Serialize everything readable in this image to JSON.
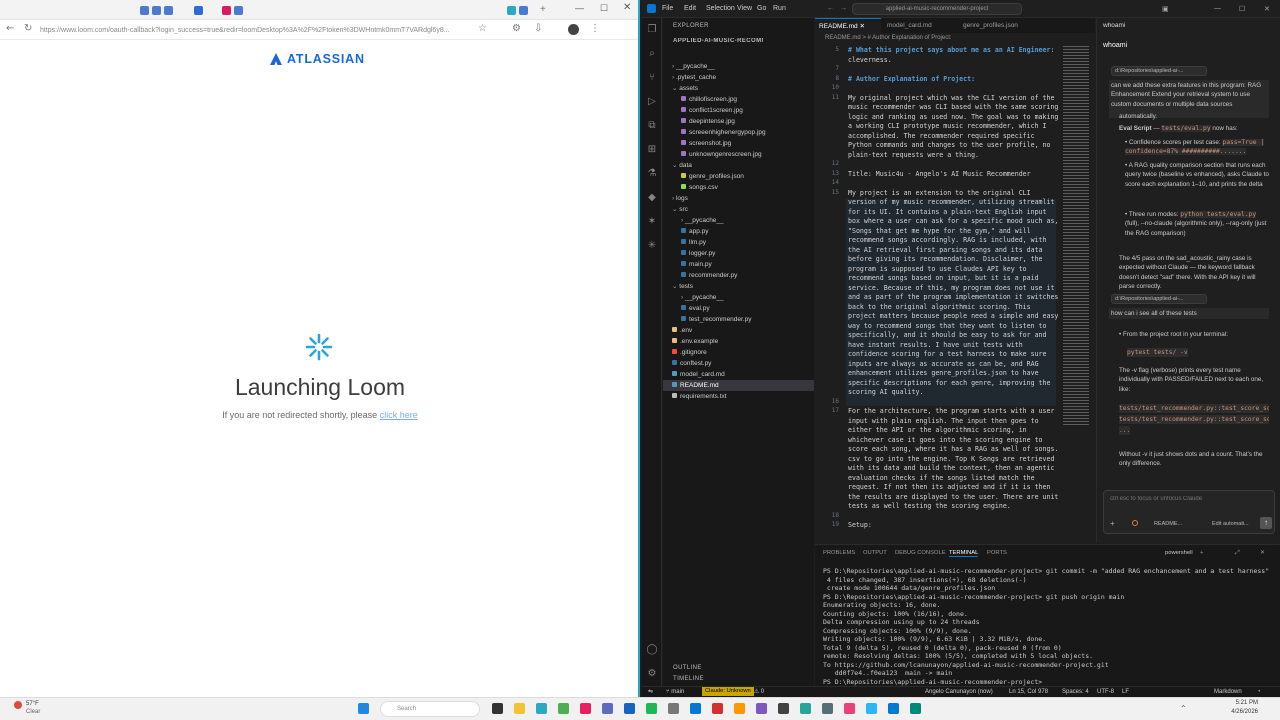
{
  "browser": {
    "url": "https://www.loom.com/oauth-callback?login_success=true&redir=loomDesktop%3A%2F%2Ftoken%3DWHntmk0mmT7VARdgl6y8...",
    "brand": "ATLASSIAN",
    "title": "Launching Loom",
    "subtitle_prefix": "If you are not redirected shortly, please",
    "subtitle_link": "click here",
    "accent": "#1868db"
  },
  "vscode": {
    "menu": [
      "File",
      "Edit",
      "Selection",
      "View",
      "Go",
      "Run"
    ],
    "command_center": "applied-ai-music-recommender-project",
    "explorer": {
      "header": "EXPLORER",
      "project": "APPLIED-AI-MUSIC-RECOMME...",
      "items": [
        {
          "label": "__pycache__",
          "indent": 1,
          "kind": "folder",
          "color": "#bbbbbb"
        },
        {
          "label": ".pytest_cache",
          "indent": 1,
          "kind": "folder",
          "color": "#bbbbbb"
        },
        {
          "label": "assets",
          "indent": 1,
          "kind": "folder-open",
          "color": "#bbbbbb"
        },
        {
          "label": "chillofiscreen.jpg",
          "indent": 2,
          "kind": "file",
          "color": "#a074c4"
        },
        {
          "label": "conflict1screen.jpg",
          "indent": 2,
          "kind": "file",
          "color": "#a074c4"
        },
        {
          "label": "deepintense.jpg",
          "indent": 2,
          "kind": "file",
          "color": "#a074c4"
        },
        {
          "label": "screeenhighenergypop.jpg",
          "indent": 2,
          "kind": "file",
          "color": "#a074c4"
        },
        {
          "label": "screenshot.jpg",
          "indent": 2,
          "kind": "file",
          "color": "#a074c4"
        },
        {
          "label": "unknowngenrescreen.jpg",
          "indent": 2,
          "kind": "file",
          "color": "#a074c4"
        },
        {
          "label": "data",
          "indent": 1,
          "kind": "folder-open",
          "color": "#bbbbbb"
        },
        {
          "label": "genre_profiles.json",
          "indent": 2,
          "kind": "file",
          "color": "#cbcb41"
        },
        {
          "label": "songs.csv",
          "indent": 2,
          "kind": "file",
          "color": "#89e051"
        },
        {
          "label": "logs",
          "indent": 1,
          "kind": "folder",
          "color": "#bbbbbb"
        },
        {
          "label": "src",
          "indent": 1,
          "kind": "folder-open",
          "color": "#bbbbbb"
        },
        {
          "label": "__pycache__",
          "indent": 2,
          "kind": "folder",
          "color": "#bbbbbb"
        },
        {
          "label": "app.py",
          "indent": 2,
          "kind": "file",
          "color": "#3572a5"
        },
        {
          "label": "llm.py",
          "indent": 2,
          "kind": "file",
          "color": "#3572a5"
        },
        {
          "label": "logger.py",
          "indent": 2,
          "kind": "file",
          "color": "#3572a5"
        },
        {
          "label": "main.py",
          "indent": 2,
          "kind": "file",
          "color": "#3572a5"
        },
        {
          "label": "recommender.py",
          "indent": 2,
          "kind": "file",
          "color": "#3572a5"
        },
        {
          "label": "tests",
          "indent": 1,
          "kind": "folder-open",
          "color": "#bbbbbb"
        },
        {
          "label": "__pycache__",
          "indent": 2,
          "kind": "folder",
          "color": "#bbbbbb"
        },
        {
          "label": "eval.py",
          "indent": 2,
          "kind": "file",
          "color": "#3572a5"
        },
        {
          "label": "test_recommender.py",
          "indent": 2,
          "kind": "file",
          "color": "#3572a5"
        },
        {
          "label": ".env",
          "indent": 1,
          "kind": "file",
          "color": "#e5c07b"
        },
        {
          "label": ".env.example",
          "indent": 1,
          "kind": "file",
          "color": "#e5c07b"
        },
        {
          "label": ".gitignore",
          "indent": 1,
          "kind": "file",
          "color": "#f14e32"
        },
        {
          "label": "conftest.py",
          "indent": 1,
          "kind": "file",
          "color": "#3572a5"
        },
        {
          "label": "model_card.md",
          "indent": 1,
          "kind": "file",
          "color": "#519aba"
        },
        {
          "label": "README.md",
          "indent": 1,
          "kind": "file",
          "color": "#519aba",
          "selected": true
        },
        {
          "label": "requirements.txt",
          "indent": 1,
          "kind": "file",
          "color": "#bbbbbb"
        }
      ],
      "outline": "OUTLINE",
      "timeline": "TIMELINE"
    },
    "editor_tabs": [
      "README.md",
      "model_card.md",
      "genre_profiles.json"
    ],
    "chat_tab": "whoami",
    "breadcrumb": "README.md > # Author Explanation of Project:",
    "code_lines": [
      {
        "n": "5",
        "t": "# What this project says about me as an AI Engineer:",
        "h": true
      },
      {
        "n": "",
        "t": "cleverness."
      },
      {
        "n": "7",
        "t": ""
      },
      {
        "n": "8",
        "t": "# Author Explanation of Project:",
        "h": true
      },
      {
        "n": "10",
        "t": ""
      },
      {
        "n": "11",
        "t": "My original project which was the CLI version of the"
      },
      {
        "n": "",
        "t": "music recommender was CLI based with the same scoring"
      },
      {
        "n": "",
        "t": "logic and ranking as used now. The goal was to making"
      },
      {
        "n": "",
        "t": "a working CLI prototype music recommender, which I"
      },
      {
        "n": "",
        "t": "accomplished. The recommender required specific"
      },
      {
        "n": "",
        "t": "Python commands and changes to the user profile, no"
      },
      {
        "n": "",
        "t": "plain-text requests were a thing."
      },
      {
        "n": "12",
        "t": ""
      },
      {
        "n": "13",
        "t": "Title: Music4u - Angelo's AI Music Recommender"
      },
      {
        "n": "14",
        "t": ""
      },
      {
        "n": "15",
        "t": "My project is an extension to the original CLI"
      },
      {
        "n": "",
        "t": "version of my music recommender, utilizing streamlit"
      },
      {
        "n": "",
        "t": "for its UI. It contains a plain-text English input"
      },
      {
        "n": "",
        "t": "box where a user can ask for a specific mood such as,"
      },
      {
        "n": "",
        "t": "\"Songs that get me hype for the gym,\" and will"
      },
      {
        "n": "",
        "t": "recommend songs accordingly. RAG is included, with"
      },
      {
        "n": "",
        "t": "the AI retrieval first parsing songs and its data"
      },
      {
        "n": "",
        "t": "before giving its recommendation. Disclaimer, the"
      },
      {
        "n": "",
        "t": "program is supposed to use Claudes API key to"
      },
      {
        "n": "",
        "t": "recommend songs based on input, but it is a paid"
      },
      {
        "n": "",
        "t": "service. Because of this, my program does not use it"
      },
      {
        "n": "",
        "t": "and as part of the program implementation it switches"
      },
      {
        "n": "",
        "t": "back to the original algorithmic scoring. This"
      },
      {
        "n": "",
        "t": "project matters because people need a simple and easy"
      },
      {
        "n": "",
        "t": "way to recommend songs that they want to listen to"
      },
      {
        "n": "",
        "t": "specifically, and it should be easy to ask for and"
      },
      {
        "n": "",
        "t": "have instant results. I have unit tests with"
      },
      {
        "n": "",
        "t": "confidence scoring for a test harness to make sure"
      },
      {
        "n": "",
        "t": "inputs are always as accurate as can be, and RAG"
      },
      {
        "n": "",
        "t": "enhancement utilizes genre_profiles.json to have"
      },
      {
        "n": "",
        "t": "specific descriptions for each genre, improving the"
      },
      {
        "n": "",
        "t": "scoring AI quality."
      },
      {
        "n": "16",
        "t": ""
      },
      {
        "n": "17",
        "t": "For the architecture, the program starts with a user"
      },
      {
        "n": "",
        "t": "input with plain english. The input then goes to"
      },
      {
        "n": "",
        "t": "either the API or the algorithmic scoring, in"
      },
      {
        "n": "",
        "t": "whichever case it goes into the scoring engine to"
      },
      {
        "n": "",
        "t": "score each song, where it has a RAG as well of songs."
      },
      {
        "n": "",
        "t": "csv to go into the engine. Top K Songs are retrieved"
      },
      {
        "n": "",
        "t": "with its data and build the context, then an agentic"
      },
      {
        "n": "",
        "t": "evaluation checks if the songs listed match the"
      },
      {
        "n": "",
        "t": "request. If not then its adjusted and if it is then"
      },
      {
        "n": "",
        "t": "the results are displayed to the user. There are unit"
      },
      {
        "n": "",
        "t": "tests as well testing the scoring engine."
      },
      {
        "n": "18",
        "t": ""
      },
      {
        "n": "19",
        "t": "Setup:"
      }
    ],
    "chat": {
      "title": "whoami",
      "context_chip": "d:\\Repositories\\applied-ai-...",
      "q1": "can we add these extra features in this program: RAG Enhancement  Extend your retrieval system to use custom documents or multiple data sources",
      "auto": "automatically.",
      "eval_label": "Eval Script",
      "eval_code": "tests/eval.py",
      "eval_rest": "now has:",
      "b1": "Confidence scores per test case:",
      "b1_code": "pass=True | confidence=87% ##########.......",
      "b2": "A RAG quality comparison section that runs each query twice (baseline vs enhanced), asks Claude to score each explanation 1–10, and prints the delta",
      "b3": "Three run modes:",
      "b3_code": "python tests/eval.py",
      "b3_rest": "(full), --no-claude (algorithmic only), --rag-only (just the RAG comparison)",
      "p1": "The 4/5 pass on the sad_acoustic_rainy case is expected without Claude — the keyword fallback doesn't detect \"sad\" there. With the API key it will parse correctly.",
      "context_chip2": "d:\\Repositories\\applied-ai-...",
      "q2": "how can i see all of these tests",
      "b4": "From the project root in your terminal:",
      "cmd1": "pytest tests/ -v",
      "p2": "The -v flag (verbose) prints every test name individually with PASSED/FAILED next to each one, like:",
      "out1": "tests/test_recommender.py::test_score_song_",
      "out2": "tests/test_recommender.py::test_score_song_",
      "out3": "...",
      "p3": "Without -v it just shows dots and a count. That's the only difference.",
      "input_placeholder": "ctrl esc to focus or unfocus Claude",
      "input_file": "README...",
      "input_mode": "Edit automati..."
    },
    "panel_tabs": [
      "PROBLEMS",
      "OUTPUT",
      "DEBUG CONSOLE",
      "TERMINAL",
      "PORTS"
    ],
    "terminal_name": "powershell",
    "terminal_lines": [
      "PS D:\\Repositories\\applied-ai-music-recommender-project> git commit -m \"added RAG enchancement and a test harness\"",
      " 4 files changed, 387 insertions(+), 68 deletions(-)",
      " create mode 100644 data/genre_profiles.json",
      "PS D:\\Repositories\\applied-ai-music-recommender-project> git push origin main",
      "Enumerating objects: 16, done.",
      "Counting objects: 100% (16/16), done.",
      "Delta compression using up to 24 threads",
      "Compressing objects: 100% (9/9), done.",
      "Writing objects: 100% (9/9), 6.63 KiB | 3.32 MiB/s, done.",
      "Total 9 (delta 5), reused 0 (delta 0), pack-reused 0 (from 0)",
      "remote: Resolving deltas: 100% (5/5), completed with 5 local objects.",
      "To https://github.com/lcanunayon/applied-ai-music-recommender-project.git",
      "   dd0f7e4..f0ea123  main -> main",
      "PS D:\\Repositories\\applied-ai-music-recommender-project> "
    ],
    "status": {
      "branch": "main",
      "claude": "Claude: Unknown",
      "problems": "⊗ 0 ⚠ 0",
      "author": "Angelo Canunayon (now)",
      "position": "Ln 15, Col 978",
      "spaces": "Spaces: 4",
      "encoding": "UTF-8",
      "eol": "LF",
      "language": "Markdown"
    }
  },
  "taskbar": {
    "weather_temp": "57°F",
    "weather_cond": "Clear",
    "search": "Search",
    "time": "5:21 PM",
    "date": "4/26/2026"
  }
}
